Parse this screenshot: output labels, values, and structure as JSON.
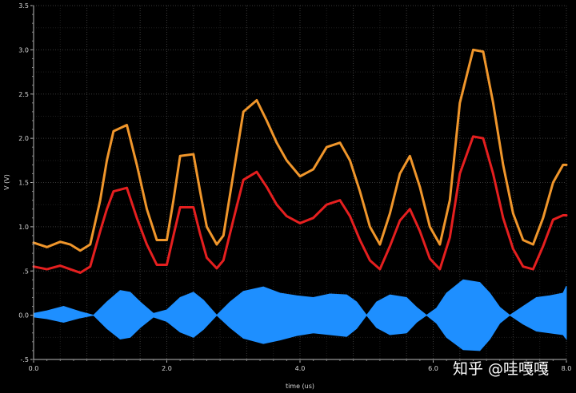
{
  "chart_data": {
    "type": "line",
    "title": "",
    "xlabel": "time (us)",
    "ylabel": "V (V)",
    "xlim": [
      0,
      8.0
    ],
    "ylim": [
      -0.5,
      3.5
    ],
    "grid": true,
    "x_ticks": [
      "0.0",
      "2.0",
      "4.0",
      "6.0",
      "8.0"
    ],
    "y_ticks": [
      "-.5",
      "0.0",
      ".5",
      "1.0",
      "1.5",
      "2.0",
      "2.5",
      "3.0",
      "3.5"
    ],
    "series": [
      {
        "color": "#f0962b",
        "x": [
          0.0,
          0.2,
          0.4,
          0.55,
          0.7,
          0.85,
          1.0,
          1.1,
          1.2,
          1.4,
          1.55,
          1.7,
          1.85,
          2.0,
          2.1,
          2.2,
          2.4,
          2.5,
          2.6,
          2.75,
          2.85,
          3.0,
          3.15,
          3.35,
          3.5,
          3.65,
          3.8,
          4.0,
          4.2,
          4.4,
          4.6,
          4.75,
          4.9,
          5.05,
          5.2,
          5.35,
          5.5,
          5.65,
          5.8,
          5.95,
          6.1,
          6.25,
          6.4,
          6.6,
          6.75,
          6.9,
          7.05,
          7.2,
          7.35,
          7.5,
          7.65,
          7.8,
          7.95,
          8.0
        ],
        "y": [
          0.82,
          0.77,
          0.83,
          0.8,
          0.73,
          0.8,
          1.3,
          1.75,
          2.08,
          2.15,
          1.7,
          1.2,
          0.85,
          0.85,
          1.3,
          1.8,
          1.82,
          1.4,
          1.0,
          0.8,
          0.9,
          1.6,
          2.3,
          2.43,
          2.2,
          1.95,
          1.75,
          1.57,
          1.65,
          1.9,
          1.95,
          1.75,
          1.4,
          1.0,
          0.8,
          1.15,
          1.6,
          1.8,
          1.45,
          1.0,
          0.8,
          1.3,
          2.4,
          3.0,
          2.98,
          2.4,
          1.7,
          1.15,
          0.85,
          0.8,
          1.1,
          1.5,
          1.7,
          1.7
        ]
      },
      {
        "color": "#e51f1f",
        "x": [
          0.0,
          0.2,
          0.4,
          0.55,
          0.7,
          0.85,
          1.0,
          1.1,
          1.2,
          1.4,
          1.55,
          1.7,
          1.85,
          2.0,
          2.1,
          2.2,
          2.4,
          2.5,
          2.6,
          2.75,
          2.85,
          3.0,
          3.15,
          3.35,
          3.5,
          3.65,
          3.8,
          4.0,
          4.2,
          4.4,
          4.6,
          4.75,
          4.9,
          5.05,
          5.2,
          5.35,
          5.5,
          5.65,
          5.8,
          5.95,
          6.1,
          6.25,
          6.4,
          6.6,
          6.75,
          6.9,
          7.05,
          7.2,
          7.35,
          7.5,
          7.65,
          7.8,
          7.95,
          8.0
        ],
        "y": [
          0.55,
          0.52,
          0.56,
          0.52,
          0.48,
          0.55,
          0.95,
          1.2,
          1.4,
          1.44,
          1.1,
          0.8,
          0.57,
          0.57,
          0.9,
          1.22,
          1.22,
          0.92,
          0.65,
          0.53,
          0.62,
          1.08,
          1.53,
          1.62,
          1.45,
          1.25,
          1.12,
          1.04,
          1.1,
          1.25,
          1.3,
          1.12,
          0.85,
          0.62,
          0.52,
          0.78,
          1.07,
          1.2,
          0.95,
          0.64,
          0.52,
          0.88,
          1.6,
          2.02,
          2.0,
          1.6,
          1.1,
          0.75,
          0.55,
          0.52,
          0.78,
          1.08,
          1.13,
          1.13
        ]
      },
      {
        "color": "#1e8fff",
        "style": "envelope",
        "x": [
          0.0,
          0.2,
          0.45,
          0.7,
          0.9,
          1.1,
          1.3,
          1.45,
          1.6,
          1.8,
          2.0,
          2.2,
          2.4,
          2.55,
          2.75,
          2.95,
          3.15,
          3.45,
          3.7,
          3.95,
          4.2,
          4.45,
          4.7,
          4.85,
          5.0,
          5.15,
          5.35,
          5.6,
          5.75,
          5.9,
          6.05,
          6.2,
          6.45,
          6.7,
          6.85,
          7.0,
          7.15,
          7.35,
          7.55,
          7.75,
          7.95,
          8.0
        ],
        "upper": [
          0.02,
          0.05,
          0.1,
          0.04,
          0.0,
          0.15,
          0.28,
          0.26,
          0.15,
          0.02,
          0.06,
          0.2,
          0.26,
          0.17,
          0.0,
          0.15,
          0.27,
          0.32,
          0.25,
          0.22,
          0.2,
          0.24,
          0.23,
          0.15,
          0.0,
          0.15,
          0.23,
          0.2,
          0.09,
          0.0,
          0.08,
          0.25,
          0.4,
          0.37,
          0.25,
          0.09,
          0.0,
          0.1,
          0.2,
          0.22,
          0.25,
          0.33
        ],
        "lower": [
          -0.02,
          -0.04,
          -0.08,
          -0.03,
          0.0,
          -0.15,
          -0.27,
          -0.25,
          -0.14,
          -0.02,
          -0.07,
          -0.19,
          -0.25,
          -0.16,
          0.0,
          -0.14,
          -0.26,
          -0.32,
          -0.28,
          -0.23,
          -0.2,
          -0.22,
          -0.24,
          -0.15,
          0.0,
          -0.14,
          -0.22,
          -0.2,
          -0.08,
          0.0,
          -0.09,
          -0.25,
          -0.39,
          -0.4,
          -0.27,
          -0.09,
          0.0,
          -0.1,
          -0.18,
          -0.2,
          -0.22,
          -0.27
        ]
      }
    ]
  },
  "watermark": "知乎 @哇嘎嘎"
}
